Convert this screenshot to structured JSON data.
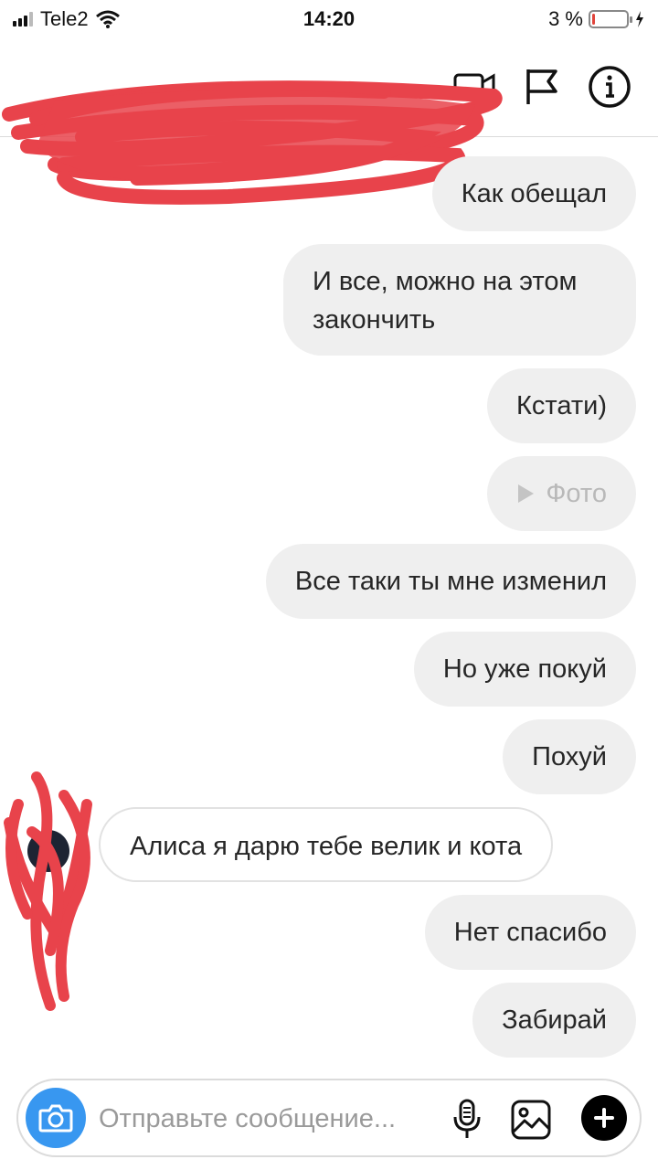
{
  "status_bar": {
    "carrier": "Tele2",
    "time": "14:20",
    "battery_text": "3 %",
    "battery_level": 0.03
  },
  "header": {
    "icons": [
      "video-call-icon",
      "flag-icon",
      "info-icon"
    ]
  },
  "messages": [
    {
      "text": "Как обещал",
      "direction": "outgoing"
    },
    {
      "text": "И все, можно на этом закончить",
      "direction": "outgoing"
    },
    {
      "text": "Кстати)",
      "direction": "outgoing"
    },
    {
      "text": "Фото",
      "direction": "outgoing",
      "type": "photo"
    },
    {
      "text": "Все таки ты мне изменил",
      "direction": "outgoing"
    },
    {
      "text": "Но уже покуй",
      "direction": "outgoing"
    },
    {
      "text": "Похуй",
      "direction": "outgoing"
    },
    {
      "text": "Алиса я дарю тебе велик и кота",
      "direction": "incoming"
    },
    {
      "text": "Нет спасибо",
      "direction": "outgoing"
    },
    {
      "text": "Забирай",
      "direction": "outgoing"
    }
  ],
  "composer": {
    "placeholder": "Отправьте сообщение..."
  },
  "colors": {
    "accent": "#3897f0",
    "bubble_bg": "#efefef",
    "redaction": "#e8434b"
  }
}
